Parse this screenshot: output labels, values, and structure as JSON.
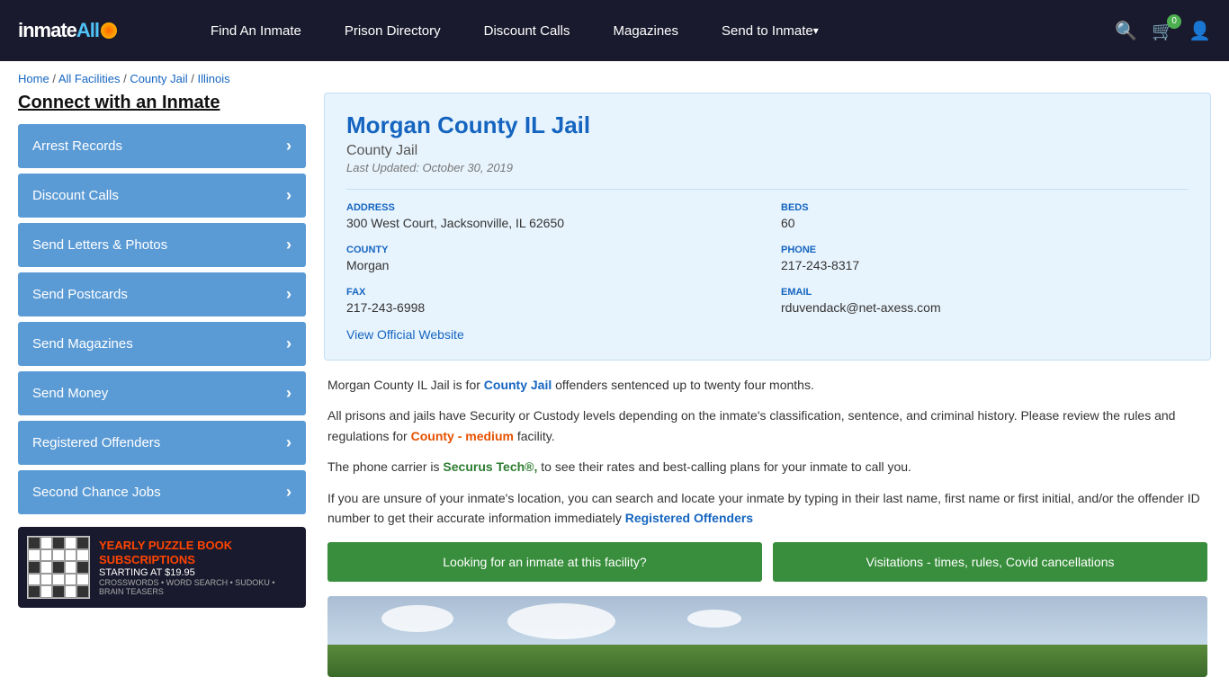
{
  "header": {
    "logo_text": "inmate",
    "logo_all": "All",
    "nav": [
      {
        "label": "Find An Inmate",
        "id": "find-inmate",
        "has_arrow": false
      },
      {
        "label": "Prison Directory",
        "id": "prison-directory",
        "has_arrow": false
      },
      {
        "label": "Discount Calls",
        "id": "discount-calls",
        "has_arrow": false
      },
      {
        "label": "Magazines",
        "id": "magazines",
        "has_arrow": false
      },
      {
        "label": "Send to Inmate",
        "id": "send-to-inmate",
        "has_arrow": true
      }
    ],
    "cart_count": "0",
    "icons": {
      "search": "🔍",
      "cart": "🛒",
      "user": "👤"
    }
  },
  "breadcrumb": {
    "items": [
      "Home",
      "All Facilities",
      "County Jail",
      "Illinois"
    ]
  },
  "sidebar": {
    "title": "Connect with an Inmate",
    "buttons": [
      {
        "label": "Arrest Records",
        "id": "arrest-records"
      },
      {
        "label": "Discount Calls",
        "id": "discount-calls-btn"
      },
      {
        "label": "Send Letters & Photos",
        "id": "send-letters"
      },
      {
        "label": "Send Postcards",
        "id": "send-postcards"
      },
      {
        "label": "Send Magazines",
        "id": "send-magazines"
      },
      {
        "label": "Send Money",
        "id": "send-money"
      },
      {
        "label": "Registered Offenders",
        "id": "registered-offenders"
      },
      {
        "label": "Second Chance Jobs",
        "id": "second-chance-jobs"
      }
    ],
    "ad": {
      "title1": "YEARLY PUZZLE BOOK",
      "title2": "SUBSCRIPTIONS",
      "price": "STARTING AT $19.95",
      "types": "CROSSWORDS • WORD SEARCH • SUDOKU • BRAIN TEASERS"
    }
  },
  "facility": {
    "name": "Morgan County IL Jail",
    "type": "County Jail",
    "last_updated": "Last Updated: October 30, 2019",
    "address_label": "ADDRESS",
    "address": "300 West Court, Jacksonville, IL 62650",
    "beds_label": "BEDS",
    "beds": "60",
    "county_label": "COUNTY",
    "county": "Morgan",
    "phone_label": "PHONE",
    "phone": "217-243-8317",
    "fax_label": "FAX",
    "fax": "217-243-6998",
    "email_label": "EMAIL",
    "email": "rduvendack@net-axess.com",
    "website_link": "View Official Website"
  },
  "description": {
    "para1_before": "Morgan County IL Jail is for ",
    "para1_link": "County Jail",
    "para1_after": " offenders sentenced up to twenty four months.",
    "para2": "All prisons and jails have Security or Custody levels depending on the inmate's classification, sentence, and criminal history. Please review the rules and regulations for ",
    "para2_link": "County - medium",
    "para2_after": " facility.",
    "para3_before": "The phone carrier is ",
    "para3_link": "Securus Tech®,",
    "para3_after": " to see their rates and best-calling plans for your inmate to call you.",
    "para4_before": "If you are unsure of your inmate's location, you can search and locate your inmate by typing in their last name, first name or first initial, and/or the offender ID number to get their accurate information immediately ",
    "para4_link": "Registered Offenders"
  },
  "action_buttons": {
    "btn1": "Looking for an inmate at this facility?",
    "btn2": "Visitations - times, rules, Covid cancellations"
  }
}
